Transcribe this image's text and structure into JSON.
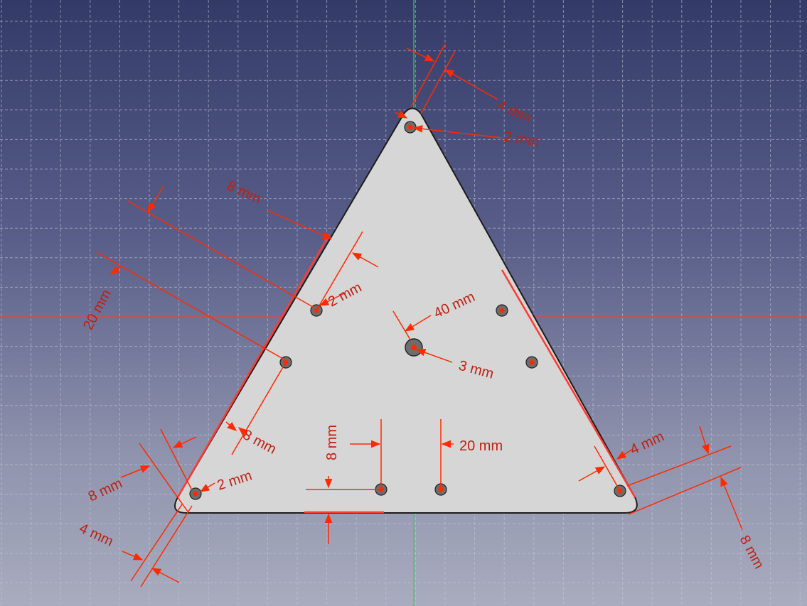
{
  "colors": {
    "bg_top": "#343a68",
    "bg_bottom": "#a9acbe",
    "grid": "#c8cbe0",
    "axis_x": "#ff3b30",
    "axis_y": "#2bd64b",
    "plate_fill": "#d6d6d6",
    "plate_edge": "#1c1c1c",
    "dimension": "#ff2a00",
    "dimension_text": "#c02010"
  },
  "dimensions": {
    "top_4": "4 mm",
    "top_2": "2 mm",
    "upper_left_8": "8 mm",
    "inner_2": "2 mm",
    "left_20": "20 mm",
    "center_40": "40 mm",
    "center_3": "3 mm",
    "mid_left_8": "8 mm",
    "bottom_8": "8 mm",
    "bottom_20": "20 mm",
    "right_4": "4 mm",
    "right_8": "8 mm",
    "bl_8": "8 mm",
    "bl_2": "2 mm",
    "bl_4": "4 mm"
  }
}
